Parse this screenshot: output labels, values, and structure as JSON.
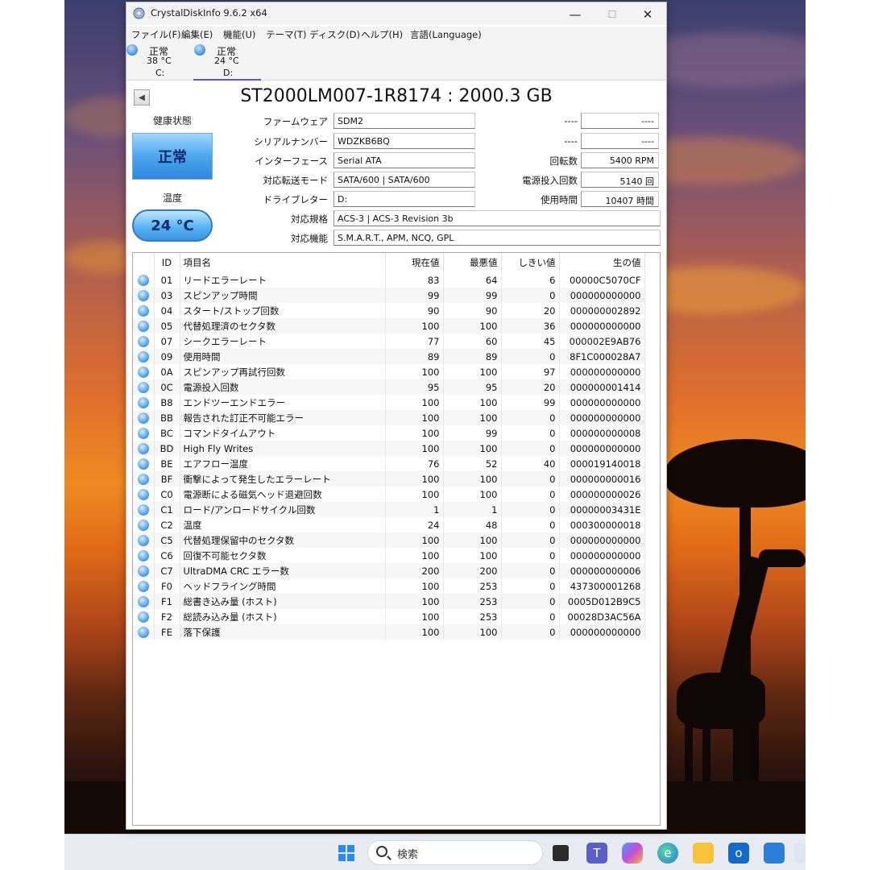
{
  "window": {
    "title": "CrystalDiskInfo 9.6.2 x64",
    "minimize": "—",
    "maximize": "☐",
    "close": "✕"
  },
  "menu": [
    "ファイル(F)",
    "編集(E)",
    "機能(U)",
    "テーマ(T)",
    "ディスク(D)",
    "ヘルプ(H)",
    "言語(Language)"
  ],
  "drives": [
    {
      "status": "正常",
      "temp": "38 °C",
      "letter": "C:"
    },
    {
      "status": "正常",
      "temp": "24 °C",
      "letter": "D:"
    }
  ],
  "disk": {
    "title": "ST2000LM007-1R8174 : 2000.3 GB",
    "health_label": "健康状態",
    "health_status": "正常",
    "temp_label": "温度",
    "temp_value": "24 °C"
  },
  "info_left": [
    {
      "label": "ファームウェア",
      "value": "SDM2"
    },
    {
      "label": "シリアルナンバー",
      "value": "WDZKB6BQ"
    },
    {
      "label": "インターフェース",
      "value": "Serial ATA"
    },
    {
      "label": "対応転送モード",
      "value": "SATA/600 | SATA/600"
    },
    {
      "label": "ドライブレター",
      "value": "D:"
    },
    {
      "label": "対応規格",
      "value": "ACS-3 | ACS-3 Revision 3b"
    },
    {
      "label": "対応機能",
      "value": "S.M.A.R.T., APM, NCQ, GPL"
    }
  ],
  "info_right": [
    {
      "label": "----",
      "value": "----"
    },
    {
      "label": "----",
      "value": "----"
    },
    {
      "label": "回転数",
      "value": "5400 RPM"
    },
    {
      "label": "電源投入回数",
      "value": "5140 回"
    },
    {
      "label": "使用時間",
      "value": "10407 時間"
    }
  ],
  "smart": {
    "headers": {
      "id": "ID",
      "name": "項目名",
      "current": "現在値",
      "worst": "最悪値",
      "threshold": "しきい値",
      "raw": "生の値"
    },
    "rows": [
      {
        "id": "01",
        "name": "リードエラーレート",
        "current": "83",
        "worst": "64",
        "threshold": "6",
        "raw": "00000C5070CF"
      },
      {
        "id": "03",
        "name": "スピンアップ時間",
        "current": "99",
        "worst": "99",
        "threshold": "0",
        "raw": "000000000000"
      },
      {
        "id": "04",
        "name": "スタート/ストップ回数",
        "current": "90",
        "worst": "90",
        "threshold": "20",
        "raw": "000000002892"
      },
      {
        "id": "05",
        "name": "代替処理済のセクタ数",
        "current": "100",
        "worst": "100",
        "threshold": "36",
        "raw": "000000000000"
      },
      {
        "id": "07",
        "name": "シークエラーレート",
        "current": "77",
        "worst": "60",
        "threshold": "45",
        "raw": "000002E9AB76"
      },
      {
        "id": "09",
        "name": "使用時間",
        "current": "89",
        "worst": "89",
        "threshold": "0",
        "raw": "8F1C000028A7"
      },
      {
        "id": "0A",
        "name": "スピンアップ再試行回数",
        "current": "100",
        "worst": "100",
        "threshold": "97",
        "raw": "000000000000"
      },
      {
        "id": "0C",
        "name": "電源投入回数",
        "current": "95",
        "worst": "95",
        "threshold": "20",
        "raw": "000000001414"
      },
      {
        "id": "B8",
        "name": "エンドツーエンドエラー",
        "current": "100",
        "worst": "100",
        "threshold": "99",
        "raw": "000000000000"
      },
      {
        "id": "BB",
        "name": "報告された訂正不可能エラー",
        "current": "100",
        "worst": "100",
        "threshold": "0",
        "raw": "000000000000"
      },
      {
        "id": "BC",
        "name": "コマンドタイムアウト",
        "current": "100",
        "worst": "99",
        "threshold": "0",
        "raw": "000000000008"
      },
      {
        "id": "BD",
        "name": "High Fly Writes",
        "current": "100",
        "worst": "100",
        "threshold": "0",
        "raw": "000000000000"
      },
      {
        "id": "BE",
        "name": "エアフロー温度",
        "current": "76",
        "worst": "52",
        "threshold": "40",
        "raw": "000019140018"
      },
      {
        "id": "BF",
        "name": "衝撃によって発生したエラーレート",
        "current": "100",
        "worst": "100",
        "threshold": "0",
        "raw": "000000000016"
      },
      {
        "id": "C0",
        "name": "電源断による磁気ヘッド退避回数",
        "current": "100",
        "worst": "100",
        "threshold": "0",
        "raw": "000000000026"
      },
      {
        "id": "C1",
        "name": "ロード/アンロードサイクル回数",
        "current": "1",
        "worst": "1",
        "threshold": "0",
        "raw": "00000003431E"
      },
      {
        "id": "C2",
        "name": "温度",
        "current": "24",
        "worst": "48",
        "threshold": "0",
        "raw": "000300000018"
      },
      {
        "id": "C5",
        "name": "代替処理保留中のセクタ数",
        "current": "100",
        "worst": "100",
        "threshold": "0",
        "raw": "000000000000"
      },
      {
        "id": "C6",
        "name": "回復不可能セクタ数",
        "current": "100",
        "worst": "100",
        "threshold": "0",
        "raw": "000000000000"
      },
      {
        "id": "C7",
        "name": "UltraDMA CRC エラー数",
        "current": "200",
        "worst": "200",
        "threshold": "0",
        "raw": "000000000006"
      },
      {
        "id": "F0",
        "name": "ヘッドフライング時間",
        "current": "100",
        "worst": "253",
        "threshold": "0",
        "raw": "437300001268"
      },
      {
        "id": "F1",
        "name": "総書き込み量 (ホスト)",
        "current": "100",
        "worst": "253",
        "threshold": "0",
        "raw": "0005D012B9C5"
      },
      {
        "id": "F2",
        "name": "総読み込み量 (ホスト)",
        "current": "100",
        "worst": "253",
        "threshold": "0",
        "raw": "00028D3AC56A"
      },
      {
        "id": "FE",
        "name": "落下保護",
        "current": "100",
        "worst": "100",
        "threshold": "0",
        "raw": "000000000000"
      }
    ]
  },
  "taskbar": {
    "search_placeholder": "検索",
    "icons": [
      "windows-start-icon",
      "task-view-icon",
      "teams-icon",
      "copilot-icon",
      "edge-icon",
      "file-explorer-icon",
      "outlook-icon",
      "store-icon"
    ]
  }
}
